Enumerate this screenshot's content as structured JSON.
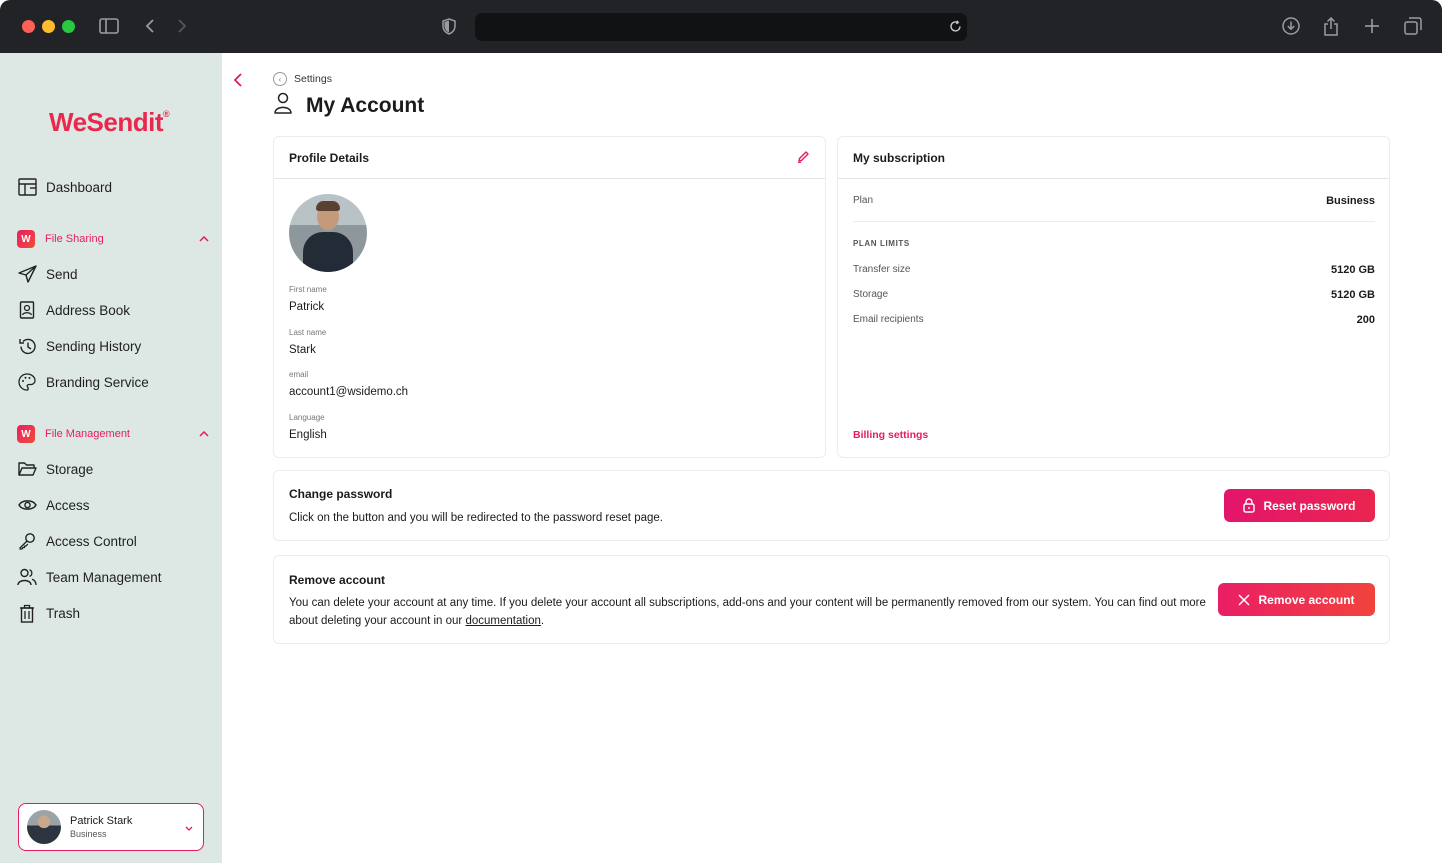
{
  "colors": {
    "accent": "#e51c60",
    "sidebar_bg": "#dde8e5",
    "chrome_bg": "#222326"
  },
  "sidebar": {
    "logo": "WeSendit",
    "dashboard": "Dashboard",
    "file_sharing": {
      "label": "File Sharing",
      "items": [
        "Send",
        "Address Book",
        "Sending History",
        "Branding Service"
      ]
    },
    "file_management": {
      "label": "File Management",
      "items": [
        "Storage",
        "Access",
        "Access Control",
        "Team Management",
        "Trash"
      ]
    },
    "user": {
      "name": "Patrick Stark",
      "plan": "Business"
    }
  },
  "breadcrumb": "Settings",
  "page_title": "My Account",
  "profile": {
    "title": "Profile Details",
    "first_name_label": "First name",
    "first_name": "Patrick",
    "last_name_label": "Last name",
    "last_name": "Stark",
    "email_label": "email",
    "email": "account1@wsidemo.ch",
    "language_label": "Language",
    "language": "English"
  },
  "subscription": {
    "title": "My subscription",
    "plan_label": "Plan",
    "plan": "Business",
    "limits_title": "PLAN LIMITS",
    "limits": [
      {
        "label": "Transfer size",
        "value": "5120 GB"
      },
      {
        "label": "Storage",
        "value": "5120 GB"
      },
      {
        "label": "Email recipients",
        "value": "200"
      }
    ],
    "billing_link": "Billing settings"
  },
  "change_password": {
    "title": "Change password",
    "text": "Click on the button and you will be redirected to the password reset page.",
    "button": "Reset password"
  },
  "remove_account": {
    "title": "Remove account",
    "text": "You can delete your account at any time. If you delete your account all subscriptions, add-ons and your content will be permanently removed from our system. You can find out more about deleting your account in our ",
    "link": "documentation",
    "after": ".",
    "button": "Remove account"
  }
}
